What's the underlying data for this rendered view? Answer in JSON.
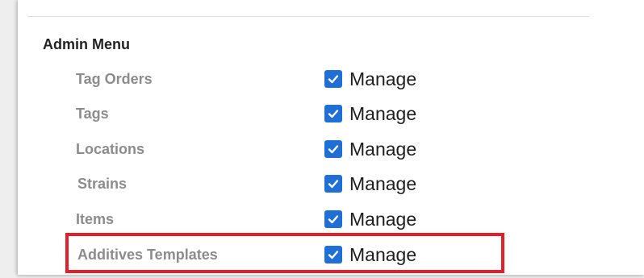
{
  "section": {
    "title": "Admin Menu"
  },
  "permissions": [
    {
      "label": "Tag Orders",
      "action": "Manage",
      "checked": true
    },
    {
      "label": "Tags",
      "action": "Manage",
      "checked": true
    },
    {
      "label": "Locations",
      "action": "Manage",
      "checked": true
    },
    {
      "label": "Strains",
      "action": "Manage",
      "checked": true
    },
    {
      "label": "Items",
      "action": "Manage",
      "checked": true
    },
    {
      "label": "Additives Templates",
      "action": "Manage",
      "checked": true
    }
  ],
  "colors": {
    "checkbox": "#1f6fd6",
    "highlight": "#e3202a",
    "label": "#8c8c8c"
  },
  "icons": {
    "checkbox": "checkmark-icon"
  }
}
